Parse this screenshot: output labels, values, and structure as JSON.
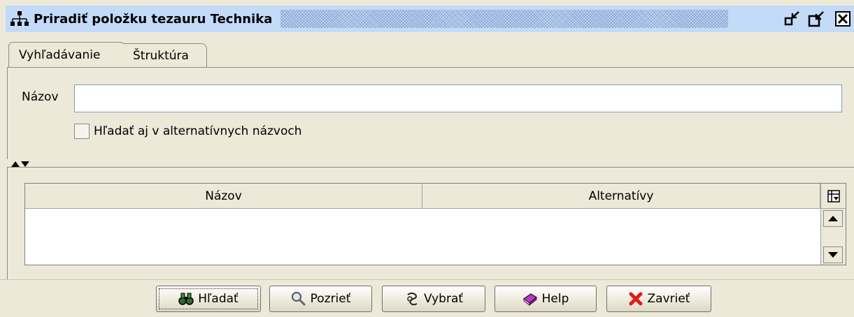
{
  "window": {
    "title": "Priradiť položku tezauru Technika",
    "icons": [
      "hierarchy-icon",
      "undock-icon",
      "dock-icon",
      "close-icon"
    ]
  },
  "tabs": [
    {
      "label": "Vyhľadávanie",
      "active": true
    },
    {
      "label": "Štruktúra",
      "active": false
    }
  ],
  "search": {
    "name_label": "Názov",
    "name_value": "",
    "alt_names_checkbox_label": "Hľadať aj v alternatívnych názvoch",
    "alt_names_checked": false
  },
  "results_table": {
    "columns": [
      "Názov",
      "Alternatívy"
    ],
    "rows": []
  },
  "buttons": {
    "search": "Hľadať",
    "view": "Pozrieť",
    "select": "Vybrať",
    "help": "Help",
    "close": "Zavrieť"
  },
  "colors": {
    "titlebar": "#c3daf9",
    "panel": "#ece9d8",
    "close_x": "#e01a1a",
    "help_book": "#b040c0"
  }
}
